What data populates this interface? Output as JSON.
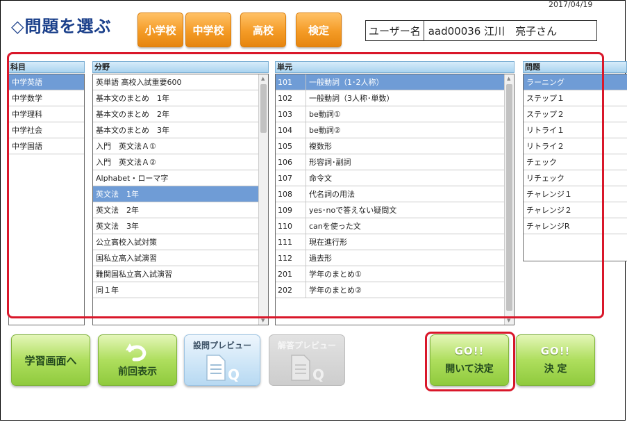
{
  "date": "2017/04/19",
  "page_title": "◇問題を選ぶ",
  "levels": [
    "小学校",
    "中学校",
    "高校",
    "検定"
  ],
  "user": {
    "label": "ユーザー名",
    "value": "aad00036 江川　亮子さん"
  },
  "columns": {
    "subject": "科目",
    "field": "分野",
    "unit": "単元",
    "problem": "問題"
  },
  "subjects": [
    "中学英語",
    "中学数学",
    "中学理科",
    "中学社会",
    "中学国語"
  ],
  "fields": [
    "英単語 高校入試重要600",
    "基本文のまとめ　1年",
    "基本文のまとめ　2年",
    "基本文のまとめ　3年",
    "入門　英文法Ａ①",
    "入門　英文法Ａ②",
    "Alphabet・ローマ字",
    "英文法　1年",
    "英文法　2年",
    "英文法　3年",
    "公立高校入試対策",
    "国私立高入試演習",
    "難関国私立高入試演習",
    "同１年"
  ],
  "units": [
    {
      "code": "101",
      "name": "一般動詞（1･2人称）"
    },
    {
      "code": "102",
      "name": "一般動詞（3人称･単数）"
    },
    {
      "code": "103",
      "name": "be動詞①"
    },
    {
      "code": "104",
      "name": "be動詞②"
    },
    {
      "code": "105",
      "name": "複数形"
    },
    {
      "code": "106",
      "name": "形容詞･副詞"
    },
    {
      "code": "107",
      "name": "命令文"
    },
    {
      "code": "108",
      "name": "代名詞の用法"
    },
    {
      "code": "109",
      "name": "yes･noで答えない疑問文"
    },
    {
      "code": "110",
      "name": "canを使った文"
    },
    {
      "code": "111",
      "name": "現在進行形"
    },
    {
      "code": "112",
      "name": "過去形"
    },
    {
      "code": "201",
      "name": "学年のまとめ①"
    },
    {
      "code": "202",
      "name": "学年のまとめ②"
    }
  ],
  "problems": [
    "ラーニング",
    "ステップ１",
    "ステップ２",
    "リトライ１",
    "リトライ２",
    "チェック",
    "リチェック",
    "チャレンジ１",
    "チャレンジ２",
    "チャレンジR"
  ],
  "buttons": {
    "study_screen": "学習画面へ",
    "previous": "前回表示",
    "question_preview": "設問プレビュー",
    "answer_preview": "解答プレビュー",
    "go_open_top": "GO!!",
    "go_open_bottom": "開いて決定",
    "go_decide_top": "GO!!",
    "go_decide_bottom": "決 定"
  },
  "selected": {
    "subject": 0,
    "field": 7,
    "unit": 0,
    "problem": 0
  },
  "colors": {
    "accent_orange": "#f49b26",
    "selection_blue": "#6f9cd6",
    "highlight_red": "#d9172a",
    "title_blue": "#1a3f8a"
  }
}
